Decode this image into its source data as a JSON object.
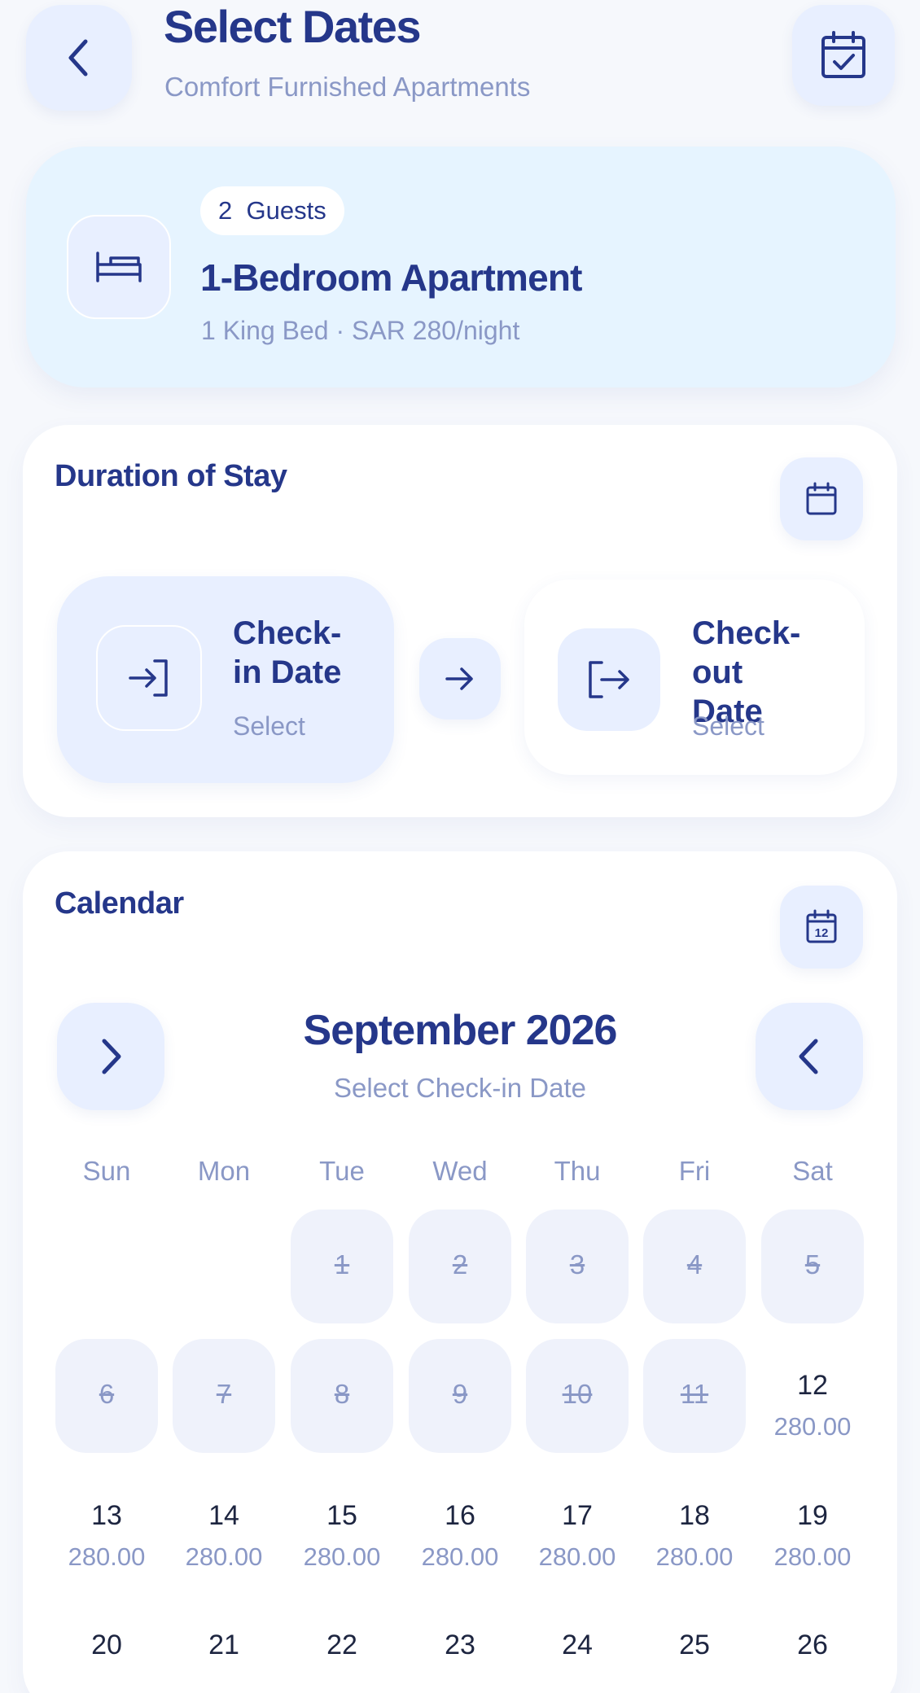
{
  "header": {
    "title": "Select Dates",
    "subtitle": "Comfort Furnished Apartments",
    "back_icon": "chevron-left-icon",
    "calendar_icon": "calendar-check-icon"
  },
  "room": {
    "guests_count": "2",
    "guests_label": "Guests",
    "name": "1-Bedroom Apartment",
    "info": "1 King Bed · SAR 280/night",
    "icon": "bed-icon"
  },
  "duration": {
    "title": "Duration of Stay",
    "checkin": {
      "label": "Check-in Date",
      "value": "Select"
    },
    "checkout": {
      "label": "Check-out Date",
      "value": "Select"
    }
  },
  "calendar": {
    "title": "Calendar",
    "month": "September 2026",
    "instruction": "Select Check-in Date",
    "weekdays": [
      "Sun",
      "Mon",
      "Tue",
      "Wed",
      "Thu",
      "Fri",
      "Sat"
    ],
    "days": [
      {
        "n": "1",
        "s": "d"
      },
      {
        "n": "2",
        "s": "d"
      },
      {
        "n": "3",
        "s": "d"
      },
      {
        "n": "4",
        "s": "d"
      },
      {
        "n": "5",
        "s": "d"
      },
      {
        "n": "6",
        "s": "d"
      },
      {
        "n": "7",
        "s": "d"
      },
      {
        "n": "8",
        "s": "d"
      },
      {
        "n": "9",
        "s": "d"
      },
      {
        "n": "10",
        "s": "d"
      },
      {
        "n": "11",
        "s": "d"
      },
      {
        "n": "12",
        "s": "a",
        "p": "280.00"
      },
      {
        "n": "13",
        "s": "a",
        "p": "280.00"
      },
      {
        "n": "14",
        "s": "a",
        "p": "280.00"
      },
      {
        "n": "15",
        "s": "a",
        "p": "280.00"
      },
      {
        "n": "16",
        "s": "a",
        "p": "280.00"
      },
      {
        "n": "17",
        "s": "a",
        "p": "280.00"
      },
      {
        "n": "18",
        "s": "a",
        "p": "280.00"
      },
      {
        "n": "19",
        "s": "a",
        "p": "280.00"
      },
      {
        "n": "20",
        "s": "a",
        "p": ""
      },
      {
        "n": "21",
        "s": "a",
        "p": ""
      },
      {
        "n": "22",
        "s": "a",
        "p": ""
      },
      {
        "n": "23",
        "s": "a",
        "p": ""
      },
      {
        "n": "24",
        "s": "a",
        "p": ""
      },
      {
        "n": "25",
        "s": "a",
        "p": ""
      },
      {
        "n": "26",
        "s": "a",
        "p": ""
      }
    ]
  },
  "colors": {
    "primary": "#25378a",
    "muted": "#8a98c6",
    "accent_bg": "#e8efff",
    "room_card_bg": "#e6f4ff",
    "disabled_bg": "#eff2fb",
    "page_bg": "#f6f8fc"
  }
}
